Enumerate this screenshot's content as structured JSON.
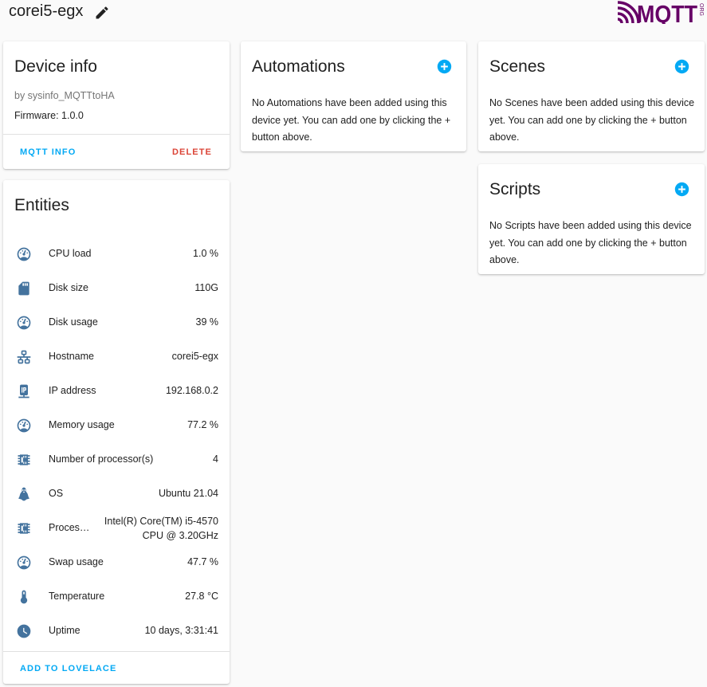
{
  "header": {
    "device_name": "corei5-egx",
    "logo_text": "MQTT",
    "logo_suffix": "ORG"
  },
  "device_info": {
    "title": "Device info",
    "by_line": "by sysinfo_MQTTtoHA",
    "firmware": "Firmware: 1.0.0",
    "mqtt_info_label": "MQTT INFO",
    "delete_label": "DELETE"
  },
  "entities": {
    "title": "Entities",
    "add_to_lovelace_label": "ADD TO LOVELACE",
    "items": [
      {
        "name": "CPU load",
        "value": "1.0 %",
        "icon": "gauge-icon"
      },
      {
        "name": "Disk size",
        "value": "110G",
        "icon": "sd-card-icon"
      },
      {
        "name": "Disk usage",
        "value": "39 %",
        "icon": "gauge-icon"
      },
      {
        "name": "Hostname",
        "value": "corei5-egx",
        "icon": "lan-icon"
      },
      {
        "name": "IP address",
        "value": "192.168.0.2",
        "icon": "ip-network-icon"
      },
      {
        "name": "Memory usage",
        "value": "77.2 %",
        "icon": "gauge-icon"
      },
      {
        "name": "Number of processor(s)",
        "value": "4",
        "icon": "chip-icon"
      },
      {
        "name": "OS",
        "value": "Ubuntu 21.04",
        "icon": "linux-penguin-icon"
      },
      {
        "name": "Proces…",
        "value_line1": "Intel(R) Core(TM) i5-4570",
        "value_line2": "CPU @ 3.20GHz",
        "icon": "chip-icon"
      },
      {
        "name": "Swap usage",
        "value": "47.7 %",
        "icon": "gauge-icon"
      },
      {
        "name": "Temperature",
        "value": "27.8 °C",
        "icon": "thermometer-icon"
      },
      {
        "name": "Uptime",
        "value": "10 days, 3:31:41",
        "icon": "clock-icon"
      }
    ]
  },
  "automations": {
    "title": "Automations",
    "empty_message": "No Automations have been added using this device yet. You can add one by clicking the + button above."
  },
  "scenes": {
    "title": "Scenes",
    "empty_message": "No Scenes have been added using this device yet. You can add one by clicking the + button above."
  },
  "scripts": {
    "title": "Scripts",
    "empty_message": "No Scripts have been added using this device yet. You can add one by clicking the + button above."
  },
  "colors": {
    "primary": "#03a9f4",
    "danger": "#db4437",
    "icon": "#44739e",
    "mqtt_purple": "#660066"
  }
}
